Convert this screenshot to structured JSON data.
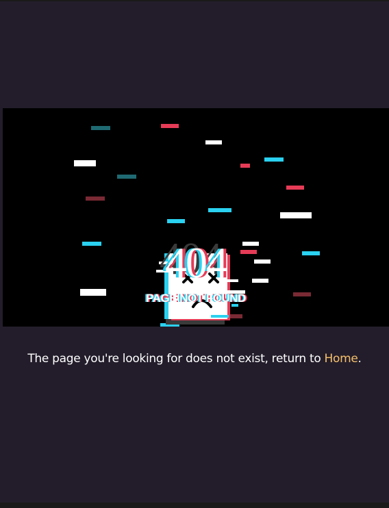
{
  "error_graphic": {
    "code": "404",
    "subtitle": "PAGE NOT FOUND"
  },
  "message": {
    "text": "The page you're looking for does not exist, return to ",
    "link_label": "Home",
    "trailing": "."
  },
  "colors": {
    "background": "#231d2b",
    "banner": "#000000",
    "link": "#f5c06b",
    "glitch_red": "#e63b57",
    "glitch_cyan": "#2ad1f0",
    "glitch_teal": "#1f6a72",
    "glitch_maroon": "#7a2a34"
  },
  "icons": {
    "face": "sad-face-icon"
  }
}
